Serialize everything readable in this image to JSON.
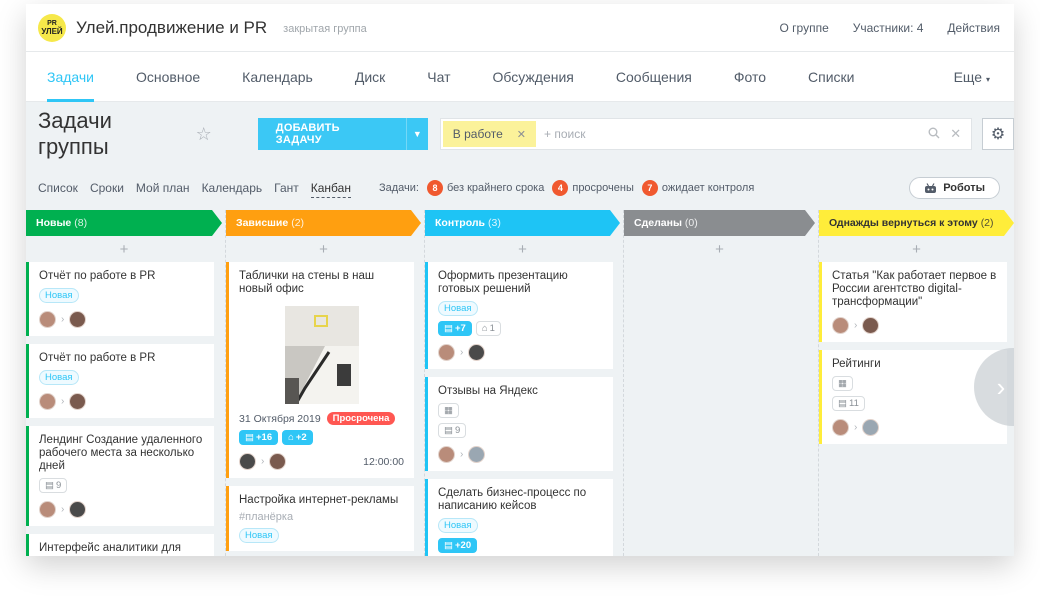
{
  "header": {
    "logo_top": "PR",
    "logo_bottom": "УЛЕЙ",
    "group_name": "Улей.продвижение и PR",
    "group_type": "закрытая группа",
    "links": [
      "О группе",
      "Участники: 4",
      "Действия"
    ]
  },
  "nav": {
    "tabs": [
      "Задачи",
      "Основное",
      "Календарь",
      "Диск",
      "Чат",
      "Обсуждения",
      "Сообщения",
      "Фото",
      "Списки"
    ],
    "active": "Задачи",
    "more": "Еще"
  },
  "toolbar": {
    "title": "Задачи группы",
    "add_task": "ДОБАВИТЬ ЗАДАЧУ",
    "filter_chip": "В работе",
    "search_placeholder": "+ поиск"
  },
  "views": {
    "tabs": [
      "Список",
      "Сроки",
      "Мой план",
      "Календарь",
      "Гант",
      "Канбан"
    ],
    "active": "Канбан",
    "counters_label": "Задачи:",
    "counters": [
      {
        "count": "8",
        "label": "без крайнего срока"
      },
      {
        "count": "4",
        "label": "просрочены"
      },
      {
        "count": "7",
        "label": "ожидает контроля"
      }
    ],
    "robots": "Роботы"
  },
  "columns": [
    {
      "title": "Новые",
      "count": "(8)",
      "color": "#00b050",
      "cards": [
        {
          "title": "Отчёт по работе в PR",
          "tag": "Новая"
        },
        {
          "title": "Отчёт по работе в PR",
          "tag": "Новая"
        },
        {
          "title": "Лендинг Создание удаленного рабочего места за несколько дней",
          "metric": "9"
        },
        {
          "title": "Интерфейс аналитики для"
        }
      ]
    },
    {
      "title": "Зависшие",
      "count": "(2)",
      "color": "#ff9f10",
      "cards": [
        {
          "title": "Таблички на стены в наш новый офис",
          "date": "31 Октября 2019",
          "overdue": "Просрочена",
          "m1": "+16",
          "m2": "+2",
          "time": "12:00:00"
        },
        {
          "title": "Настройка интернет-рекламы",
          "hash": "#планёрка",
          "tag": "Новая"
        }
      ]
    },
    {
      "title": "Контроль",
      "count": "(3)",
      "color": "#1ec4f5",
      "cards": [
        {
          "title": "Оформить презентацию готовых решений",
          "tag": "Новая",
          "m1": "+7",
          "m2": "1"
        },
        {
          "title": "Отзывы на Яндекс",
          "metric": "9"
        },
        {
          "title": "Сделать бизнес-процесс по написанию кейсов",
          "tag": "Новая",
          "m1": "+20"
        }
      ]
    },
    {
      "title": "Сделаны",
      "count": "(0)",
      "color": "#8a8d90",
      "cards": []
    },
    {
      "title": "Однажды вернуться к этому",
      "count": "(2)",
      "color": "#ffed3a",
      "cards": [
        {
          "title": "Статья \"Как работает первое в России агентство digital-трансформации\""
        },
        {
          "title": "Рейтинги",
          "metric": "11"
        }
      ]
    }
  ],
  "icons": {
    "star": "star-icon",
    "search": "search-icon",
    "clear": "close-icon",
    "settings": "gear-icon",
    "robot": "robot-icon",
    "next": "chevron-right-icon"
  }
}
